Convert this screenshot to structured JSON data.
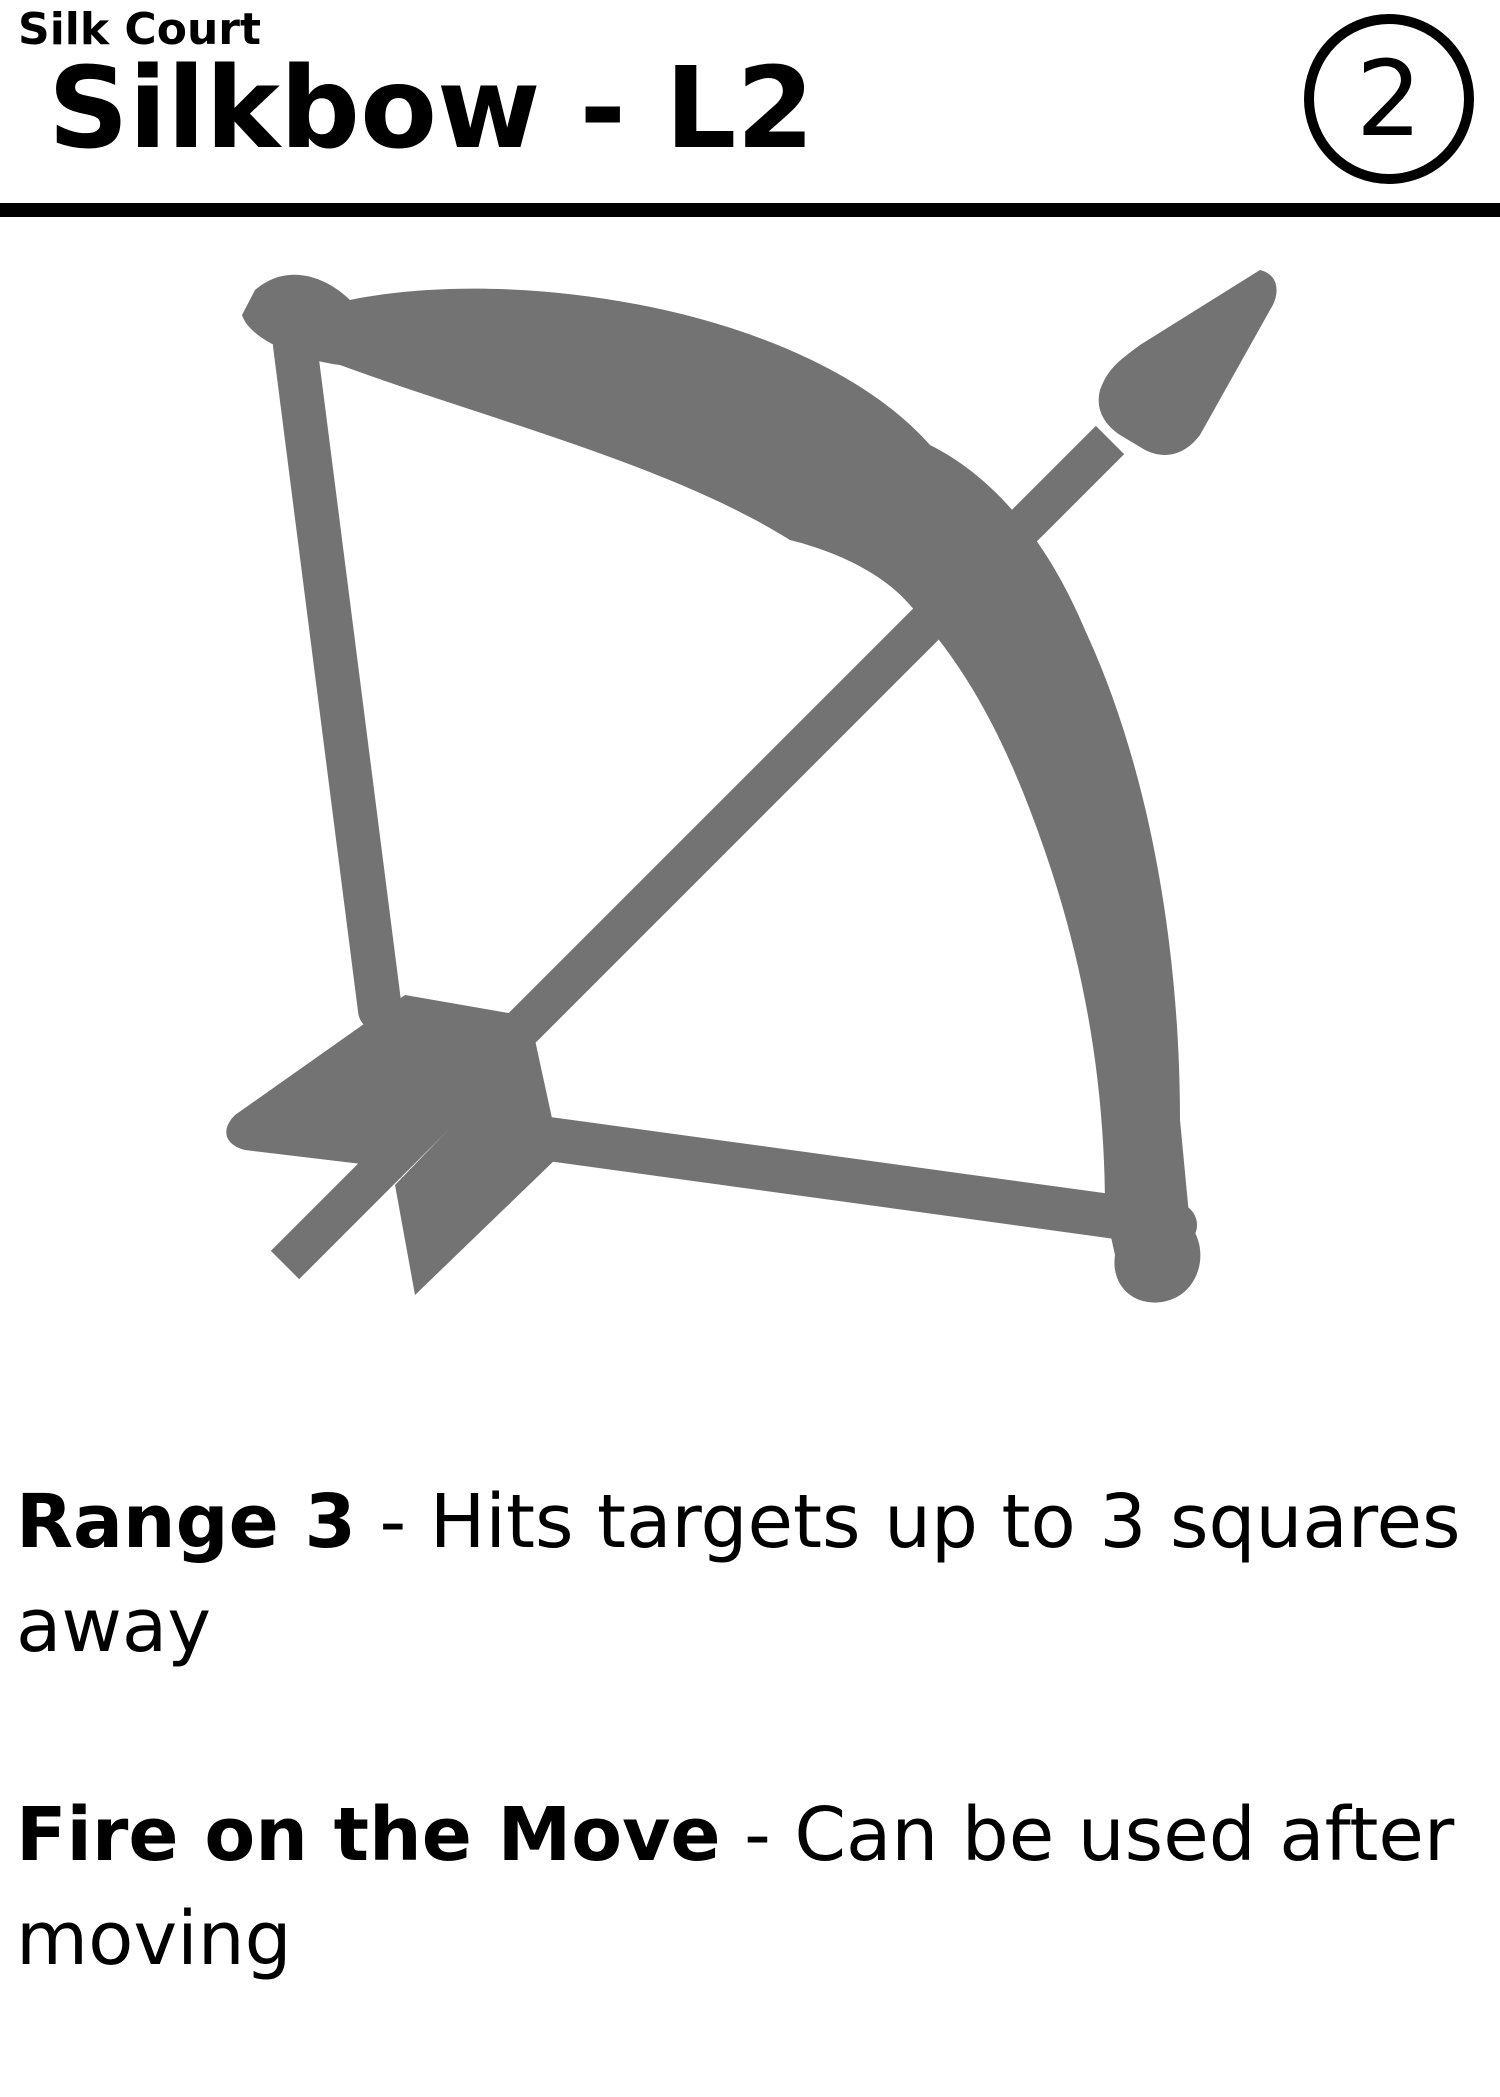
{
  "card": {
    "faction": "Silk Court",
    "title": "Silkbow - L2",
    "cost": "2",
    "art_icon": "bow-and-arrow-icon",
    "art_color": "#737373"
  },
  "abilities": [
    {
      "name": "Range 3",
      "separator": " - ",
      "description": "Hits targets up to 3 squares away"
    },
    {
      "name": "Fire on the Move",
      "separator": " - ",
      "description": "Can be used after moving"
    }
  ]
}
